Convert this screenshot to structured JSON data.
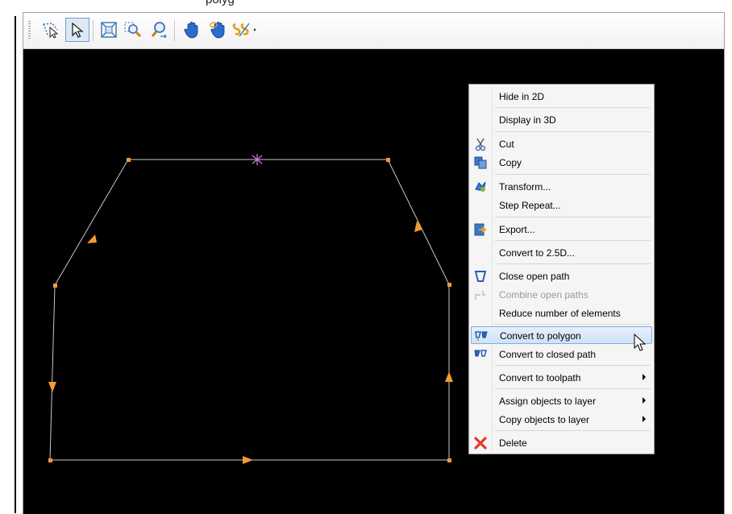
{
  "header": {
    "partial_title": "polyg"
  },
  "toolbar": {
    "buttons": [
      {
        "name": "lasso-select-icon"
      },
      {
        "name": "select-arrow-icon"
      },
      {
        "name": "zoom-extents-icon"
      },
      {
        "name": "zoom-window-icon"
      },
      {
        "name": "zoom-dynamic-icon"
      },
      {
        "name": "pan-hand-icon"
      },
      {
        "name": "pan-3d-hand-icon"
      },
      {
        "name": "snap-options-icon"
      }
    ]
  },
  "colors": {
    "canvas_bg": "#000000",
    "path_line": "#c8c8c8",
    "node": "#f39a32",
    "direction_arrow": "#f39a32",
    "start_marker": "#c878d8",
    "menu_bg": "#f5f5f5",
    "menu_highlight": "#cfe2f8",
    "delete_icon": "#e23b2a"
  },
  "context_menu": {
    "hide_2d": "Hide in 2D",
    "display_3d": "Display in 3D",
    "cut": "Cut",
    "copy": "Copy",
    "transform": "Transform...",
    "step_repeat": "Step  Repeat...",
    "export": "Export...",
    "convert_25d": "Convert to 2.5D...",
    "close_open_path": "Close open path",
    "combine_open_paths": "Combine open paths",
    "reduce_elements": "Reduce number of elements",
    "convert_polygon": "Convert to polygon",
    "convert_closed_path": "Convert to closed path",
    "convert_toolpath": "Convert to toolpath",
    "assign_layer": "Assign objects to layer",
    "copy_layer": "Copy objects to layer",
    "delete": "Delete"
  }
}
